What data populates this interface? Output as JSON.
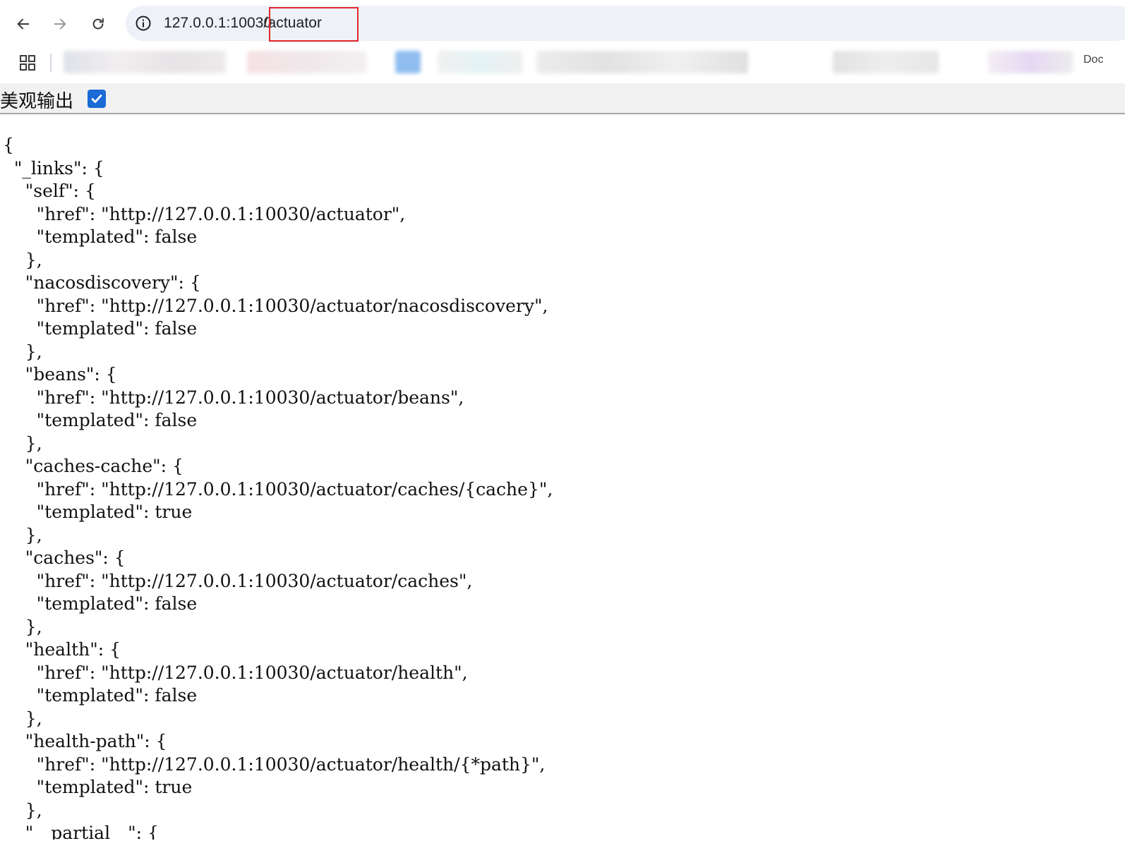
{
  "browser": {
    "url_host": "127.0.0.1:1003",
    "url_port_tail": "0",
    "url_path": "/actuator",
    "bookmark_partial_label": "Doc",
    "icons": [
      "back-arrow-icon",
      "forward-arrow-icon",
      "reload-icon",
      "site-info-icon",
      "apps-grid-icon"
    ]
  },
  "pretty_print": {
    "label": "美观输出",
    "checked": true
  },
  "json_text": "{\n  \"_links\": {\n    \"self\": {\n      \"href\": \"http://127.0.0.1:10030/actuator\",\n      \"templated\": false\n    },\n    \"nacosdiscovery\": {\n      \"href\": \"http://127.0.0.1:10030/actuator/nacosdiscovery\",\n      \"templated\": false\n    },\n    \"beans\": {\n      \"href\": \"http://127.0.0.1:10030/actuator/beans\",\n      \"templated\": false\n    },\n    \"caches-cache\": {\n      \"href\": \"http://127.0.0.1:10030/actuator/caches/{cache}\",\n      \"templated\": true\n    },\n    \"caches\": {\n      \"href\": \"http://127.0.0.1:10030/actuator/caches\",\n      \"templated\": false\n    },\n    \"health\": {\n      \"href\": \"http://127.0.0.1:10030/actuator/health\",\n      \"templated\": false\n    },\n    \"health-path\": {\n      \"href\": \"http://127.0.0.1:10030/actuator/health/{*path}\",\n      \"templated\": true\n    },\n    \"__partial__\": {"
}
